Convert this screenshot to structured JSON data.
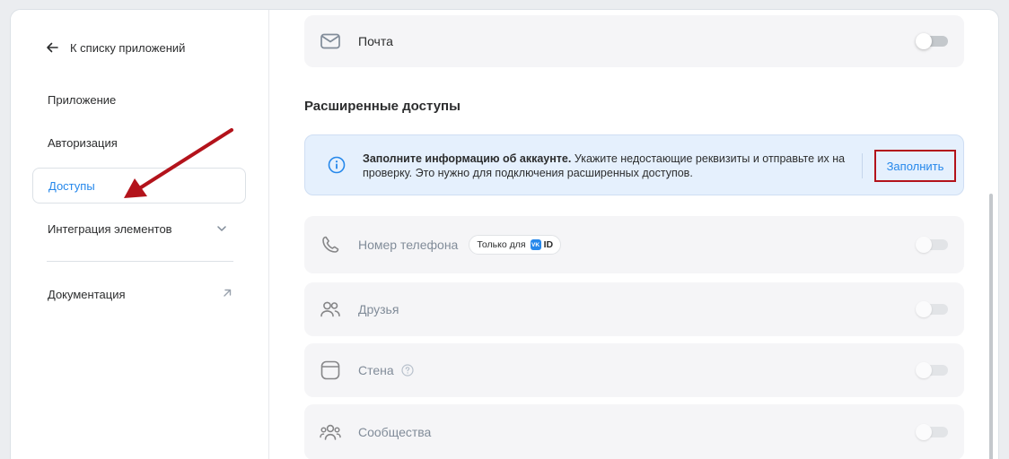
{
  "sidebar": {
    "back_label": "К списку приложений",
    "items": [
      {
        "label": "Приложение"
      },
      {
        "label": "Авторизация"
      },
      {
        "label": "Доступы"
      },
      {
        "label": "Интеграция элементов"
      },
      {
        "label": "Документация"
      }
    ]
  },
  "main": {
    "mail_label": "Почта",
    "section_title": "Расширенные доступы",
    "info": {
      "bold": "Заполните информацию об аккаунте.",
      "text": " Укажите недостающие реквизиты и отправьте их на проверку. Это нужно для подключения расширенных доступов.",
      "button": "Заполнить"
    },
    "rows": [
      {
        "label": "Номер телефона",
        "badge": "Только для",
        "badge_logo": "VK",
        "badge_id": "ID"
      },
      {
        "label": "Друзья"
      },
      {
        "label": "Стена"
      },
      {
        "label": "Сообщества"
      }
    ]
  },
  "colors": {
    "accent": "#2688eb",
    "annotation": "#b3131b",
    "info_bg": "#e5f0fd"
  }
}
